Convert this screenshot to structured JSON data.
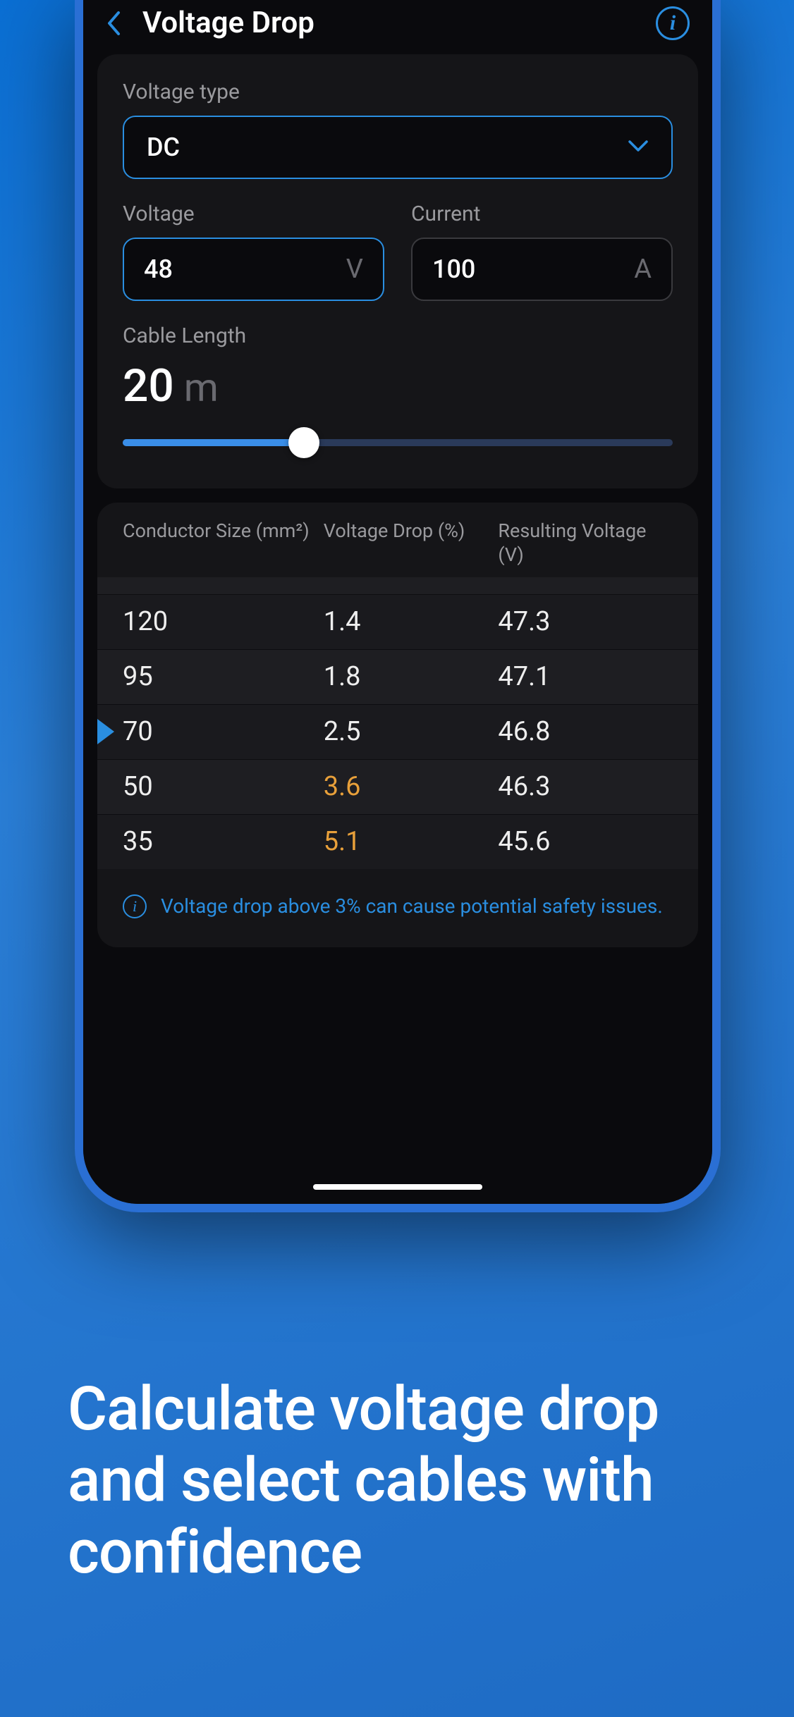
{
  "header": {
    "title": "Voltage Drop"
  },
  "form": {
    "voltage_type_label": "Voltage type",
    "voltage_type_value": "DC",
    "voltage_label": "Voltage",
    "voltage_value": "48",
    "voltage_unit": "V",
    "current_label": "Current",
    "current_value": "100",
    "current_unit": "A",
    "cable_length_label": "Cable Length",
    "cable_length_value": "20",
    "cable_length_unit": "m"
  },
  "table": {
    "headers": {
      "size": "Conductor Size (mm²)",
      "drop": "Voltage Drop (%)",
      "result": "Resulting Voltage (V)"
    },
    "rows": [
      {
        "size": "120",
        "drop": "1.4",
        "result": "47.3",
        "warn": false
      },
      {
        "size": "95",
        "drop": "1.8",
        "result": "47.1",
        "warn": false
      },
      {
        "size": "70",
        "drop": "2.5",
        "result": "46.8",
        "warn": false,
        "selected": true
      },
      {
        "size": "50",
        "drop": "3.6",
        "result": "46.3",
        "warn": true
      },
      {
        "size": "35",
        "drop": "5.1",
        "result": "45.6",
        "warn": true
      }
    ],
    "warning_text": "Voltage drop above 3% can cause potential safety issues."
  },
  "marketing": {
    "tagline": "Calculate voltage drop and select cables with confidence"
  },
  "colors": {
    "accent": "#2a8ee0",
    "warn": "#e8a03a",
    "bg_panel": "#151518"
  }
}
